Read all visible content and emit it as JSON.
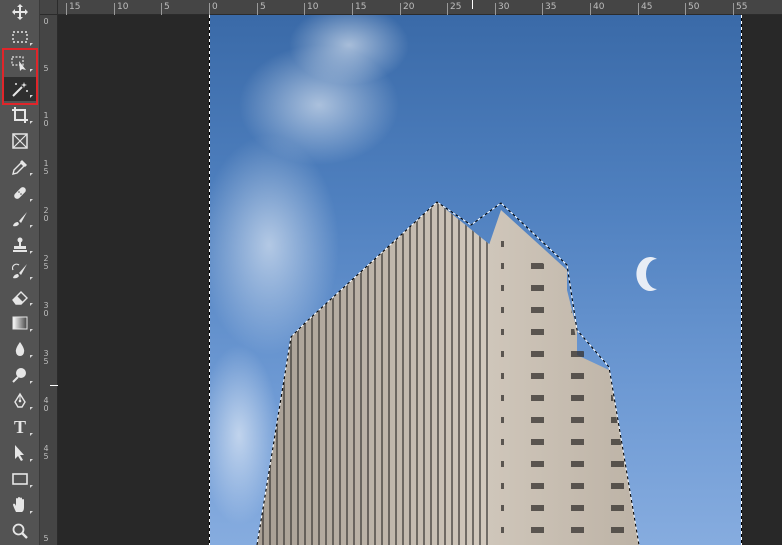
{
  "toolbar": {
    "tools": [
      {
        "name": "move-tool",
        "icon": "move-icon"
      },
      {
        "name": "marquee-tool",
        "icon": "rect-marquee-icon"
      },
      {
        "name": "object-selection-tool",
        "icon": "object-selection-icon"
      },
      {
        "name": "magic-wand-tool",
        "icon": "magic-wand-icon",
        "active": true
      },
      {
        "name": "crop-tool",
        "icon": "crop-icon"
      },
      {
        "name": "frame-tool",
        "icon": "frame-icon"
      },
      {
        "name": "eyedropper-tool",
        "icon": "eyedropper-icon"
      },
      {
        "name": "healing-brush-tool",
        "icon": "bandage-icon"
      },
      {
        "name": "brush-tool",
        "icon": "brush-icon"
      },
      {
        "name": "clone-stamp-tool",
        "icon": "stamp-icon"
      },
      {
        "name": "history-brush-tool",
        "icon": "history-brush-icon"
      },
      {
        "name": "eraser-tool",
        "icon": "eraser-icon"
      },
      {
        "name": "gradient-tool",
        "icon": "gradient-icon"
      },
      {
        "name": "blur-tool",
        "icon": "drop-icon"
      },
      {
        "name": "dodge-tool",
        "icon": "dodge-icon"
      },
      {
        "name": "pen-tool",
        "icon": "pen-icon"
      },
      {
        "name": "type-tool",
        "icon": "type-icon",
        "glyph": "T"
      },
      {
        "name": "path-selection-tool",
        "icon": "arrow-icon"
      },
      {
        "name": "rectangle-tool",
        "icon": "rectangle-icon"
      },
      {
        "name": "hand-tool",
        "icon": "hand-icon"
      },
      {
        "name": "zoom-tool",
        "icon": "zoom-icon"
      }
    ]
  },
  "ruler_top": {
    "labels": [
      "15",
      "10",
      "5",
      "0",
      "5",
      "10",
      "15",
      "20",
      "25",
      "30",
      "35",
      "40",
      "45",
      "50",
      "55"
    ]
  },
  "ruler_left": {
    "labels": [
      "0",
      "5",
      "10",
      "15",
      "20",
      "25",
      "30",
      "35",
      "40",
      "45",
      "5"
    ]
  },
  "colors": {
    "ui_dark": "#282828",
    "toolbar": "#535353",
    "ruler": "#454545",
    "highlight": "#e0252a",
    "sky": "#4f80bf"
  }
}
